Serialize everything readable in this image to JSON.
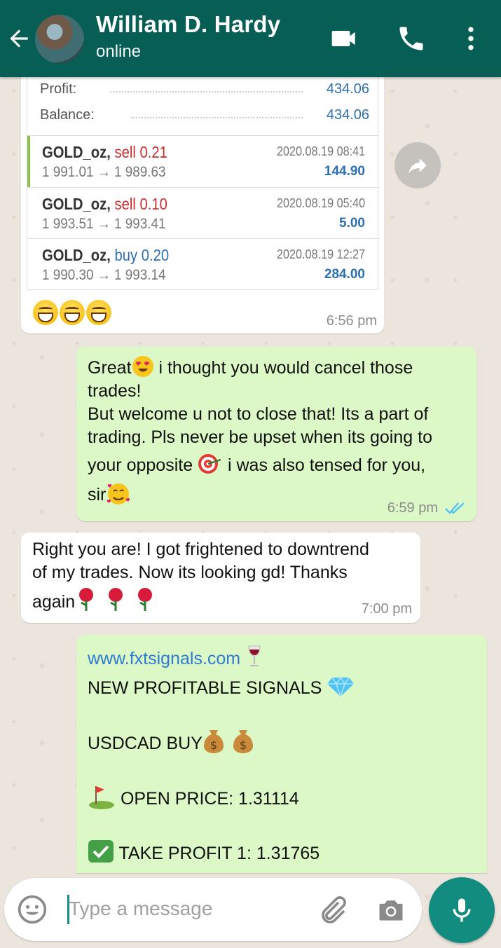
{
  "header": {
    "title": "William D. Hardy",
    "subtitle": "online"
  },
  "card": {
    "profit_label": "Profit:",
    "profit_value": "434.06",
    "balance_label": "Balance:",
    "balance_value": "434.06",
    "trades": [
      {
        "symbol": "GOLD_oz,",
        "side": "sell 0.21",
        "prices": "1 991.01 → 1 989.63",
        "date": "2020.08.19 08:41",
        "pnl": "144.90"
      },
      {
        "symbol": "GOLD_oz,",
        "side": "sell 0.10",
        "prices": "1 993.51 → 1 993.41",
        "date": "2020.08.19 05:40",
        "pnl": "5.00"
      },
      {
        "symbol": "GOLD_oz,",
        "side": "buy 0.20",
        "prices": "1 990.30 → 1 993.14",
        "date": "2020.08.19 12:27",
        "pnl": "284.00"
      }
    ],
    "time": "6:56 pm"
  },
  "messages": {
    "m1": {
      "l1a": "Great",
      "l1b": " i thought you would cancel those",
      "l2": "trades!",
      "l3": "But welcome u not to close that! Its a part of",
      "l4": "trading. Pls never be upset when its going to",
      "l5a": "your opposite ",
      "l5b": " i was also tensed for you,",
      "l6": "sir",
      "time": "6:59 pm"
    },
    "m2": {
      "l1": "Right you are! I got frightened to downtrend",
      "l2": "of my trades. Now its looking gd! Thanks",
      "l3": "again",
      "time": "7:00 pm"
    },
    "m3": {
      "link": "www.fxtsignals.com",
      "l1": "NEW PROFITABLE SIGNALS ",
      "l2": "USDCAD BUY",
      "l3": " OPEN PRICE: 1.31114",
      "l4": " TAKE PROFIT 1: 1.31765"
    }
  },
  "input": {
    "placeholder": "Type a message"
  },
  "colors": {
    "header": "#075e54",
    "outgoing": "#dcf8c6",
    "incoming": "#ffffff",
    "mic": "#128c7e",
    "read_ticks": "#4fc3f7"
  }
}
